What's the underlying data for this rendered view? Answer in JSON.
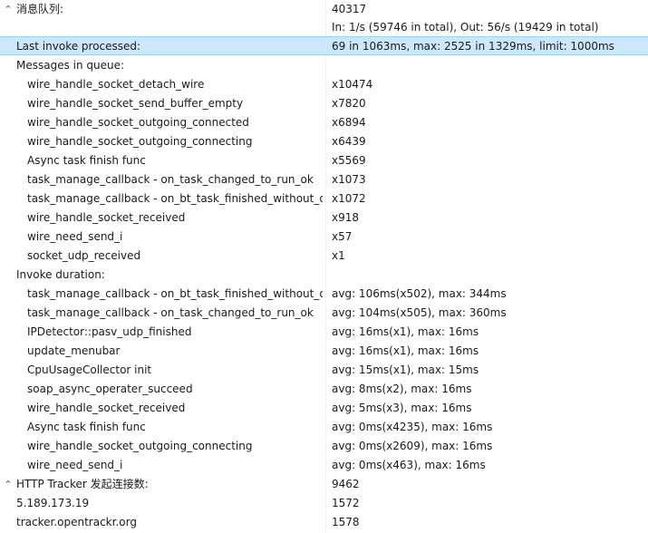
{
  "rows": [
    {
      "name": "消息队列:",
      "value": "40317"
    },
    {
      "name": "",
      "value": "In: 1/s (59746 in total), Out: 56/s (19429 in total)"
    },
    {
      "name": "Last invoke processed:",
      "value": "69 in 1063ms, max: 2525 in 1329ms, limit: 1000ms"
    },
    {
      "name": "Messages in queue:",
      "value": ""
    },
    {
      "name": "wire_handle_socket_detach_wire",
      "value": "x10474"
    },
    {
      "name": "wire_handle_socket_send_buffer_empty",
      "value": "x7820"
    },
    {
      "name": "wire_handle_socket_outgoing_connected",
      "value": "x6894"
    },
    {
      "name": "wire_handle_socket_outgoing_connecting",
      "value": "x6439"
    },
    {
      "name": "Async task finish func",
      "value": "x5569"
    },
    {
      "name": "task_manage_callback - on_task_changed_to_run_ok",
      "value": "x1073"
    },
    {
      "name": "task_manage_callback - on_bt_task_finished_without_d...",
      "value": "x1072"
    },
    {
      "name": "wire_handle_socket_received",
      "value": "x918"
    },
    {
      "name": "wire_need_send_i",
      "value": "x57"
    },
    {
      "name": "socket_udp_received",
      "value": "x1"
    },
    {
      "name": "Invoke duration:",
      "value": ""
    },
    {
      "name": "task_manage_callback - on_bt_task_finished_without_d...",
      "value": "avg: 106ms(x502), max: 344ms"
    },
    {
      "name": "task_manage_callback - on_task_changed_to_run_ok",
      "value": "avg: 104ms(x505), max: 360ms"
    },
    {
      "name": "IPDetector::pasv_udp_finished",
      "value": "avg: 16ms(x1), max: 16ms"
    },
    {
      "name": "update_menubar",
      "value": "avg: 16ms(x1), max: 16ms"
    },
    {
      "name": "CpuUsageCollector init",
      "value": "avg: 15ms(x1), max: 15ms"
    },
    {
      "name": "soap_async_operater_succeed",
      "value": "avg: 8ms(x2), max: 16ms"
    },
    {
      "name": "wire_handle_socket_received",
      "value": "avg: 5ms(x3), max: 16ms"
    },
    {
      "name": "Async task finish func",
      "value": "avg: 0ms(x4235), max: 16ms"
    },
    {
      "name": "wire_handle_socket_outgoing_connecting",
      "value": "avg: 0ms(x2609), max: 16ms"
    },
    {
      "name": "wire_need_send_i",
      "value": "avg: 0ms(x463), max: 16ms"
    },
    {
      "name": "HTTP Tracker 发起连接数:",
      "value": "9462"
    },
    {
      "name": "5.189.173.19",
      "value": "1572"
    },
    {
      "name": "tracker.opentrackr.org",
      "value": "1578"
    }
  ],
  "icons": {
    "expand": "chevron-up-icon"
  },
  "colors": {
    "selection_bg": "#cce8ff",
    "selection_border": "#99d1ff"
  }
}
